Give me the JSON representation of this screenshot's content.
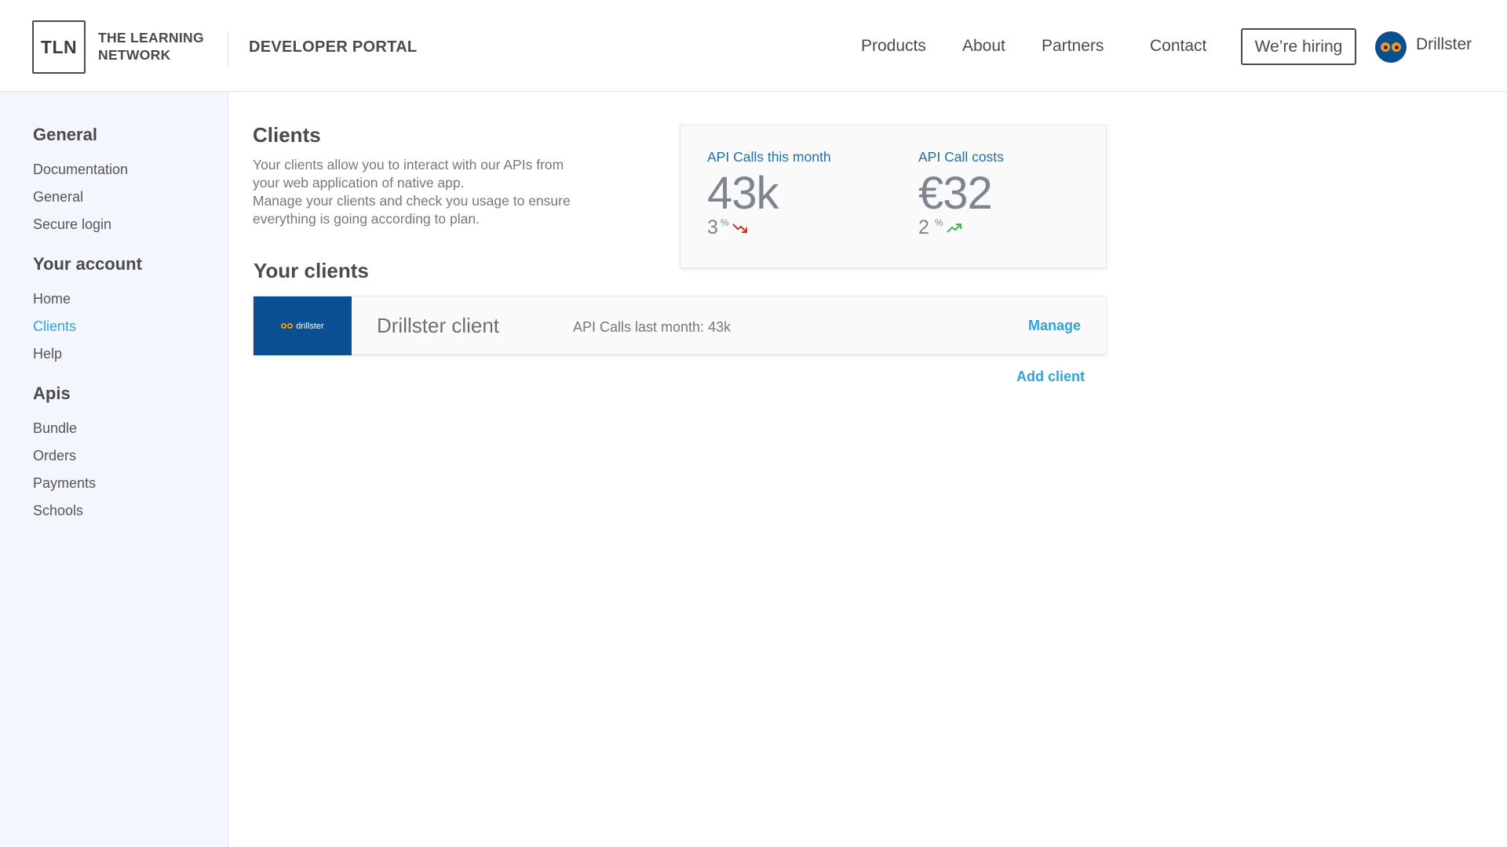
{
  "header": {
    "logo_mark": "TLN",
    "logo_line1": "THE LEARNING",
    "logo_line2": "NETWORK",
    "portal_title": "DEVELOPER PORTAL",
    "nav": [
      "Products",
      "About",
      "Partners",
      "Contact"
    ],
    "hiring_label": "We’re hiring",
    "user_name": "Drillster",
    "user_avatar_icon": "owl-avatar-icon"
  },
  "sidebar": {
    "sections": [
      {
        "heading": "General",
        "items": [
          "Documentation",
          "General",
          "Secure login"
        ]
      },
      {
        "heading": "Your account",
        "items": [
          "Home",
          "Clients",
          "Help"
        ]
      },
      {
        "heading": "Apis",
        "items": [
          "Bundle",
          "Orders",
          "Payments",
          "Schools"
        ]
      }
    ],
    "active_item": "Clients"
  },
  "main": {
    "title": "Clients",
    "description_line1": "Your clients allow you to interact with our APIs from",
    "description_line2": "your web application of native app.",
    "description_line3": "Manage your clients and check you usage to ensure",
    "description_line4": "everything is going according to plan.",
    "stats": [
      {
        "label": "API Calls this month",
        "value": "43k",
        "change": "3",
        "unit": "%",
        "trend": "down",
        "trend_color": "#c0392b"
      },
      {
        "label": "API Call costs",
        "value": "€32",
        "change": "2",
        "unit": "%",
        "trend": "up",
        "trend_color": "#3dbb4c"
      }
    ],
    "clients_heading": "Your clients",
    "clients": [
      {
        "logo_text": "drillster",
        "name": "Drillster client",
        "usage": "API Calls last month: 43k",
        "action": "Manage"
      }
    ],
    "add_client_label": "Add client"
  },
  "colors": {
    "accent": "#2ea3dc",
    "stat_label": "#1f6fab",
    "brand_blue": "#0b4f93",
    "sidebar_bg": "#f3f6fc"
  }
}
